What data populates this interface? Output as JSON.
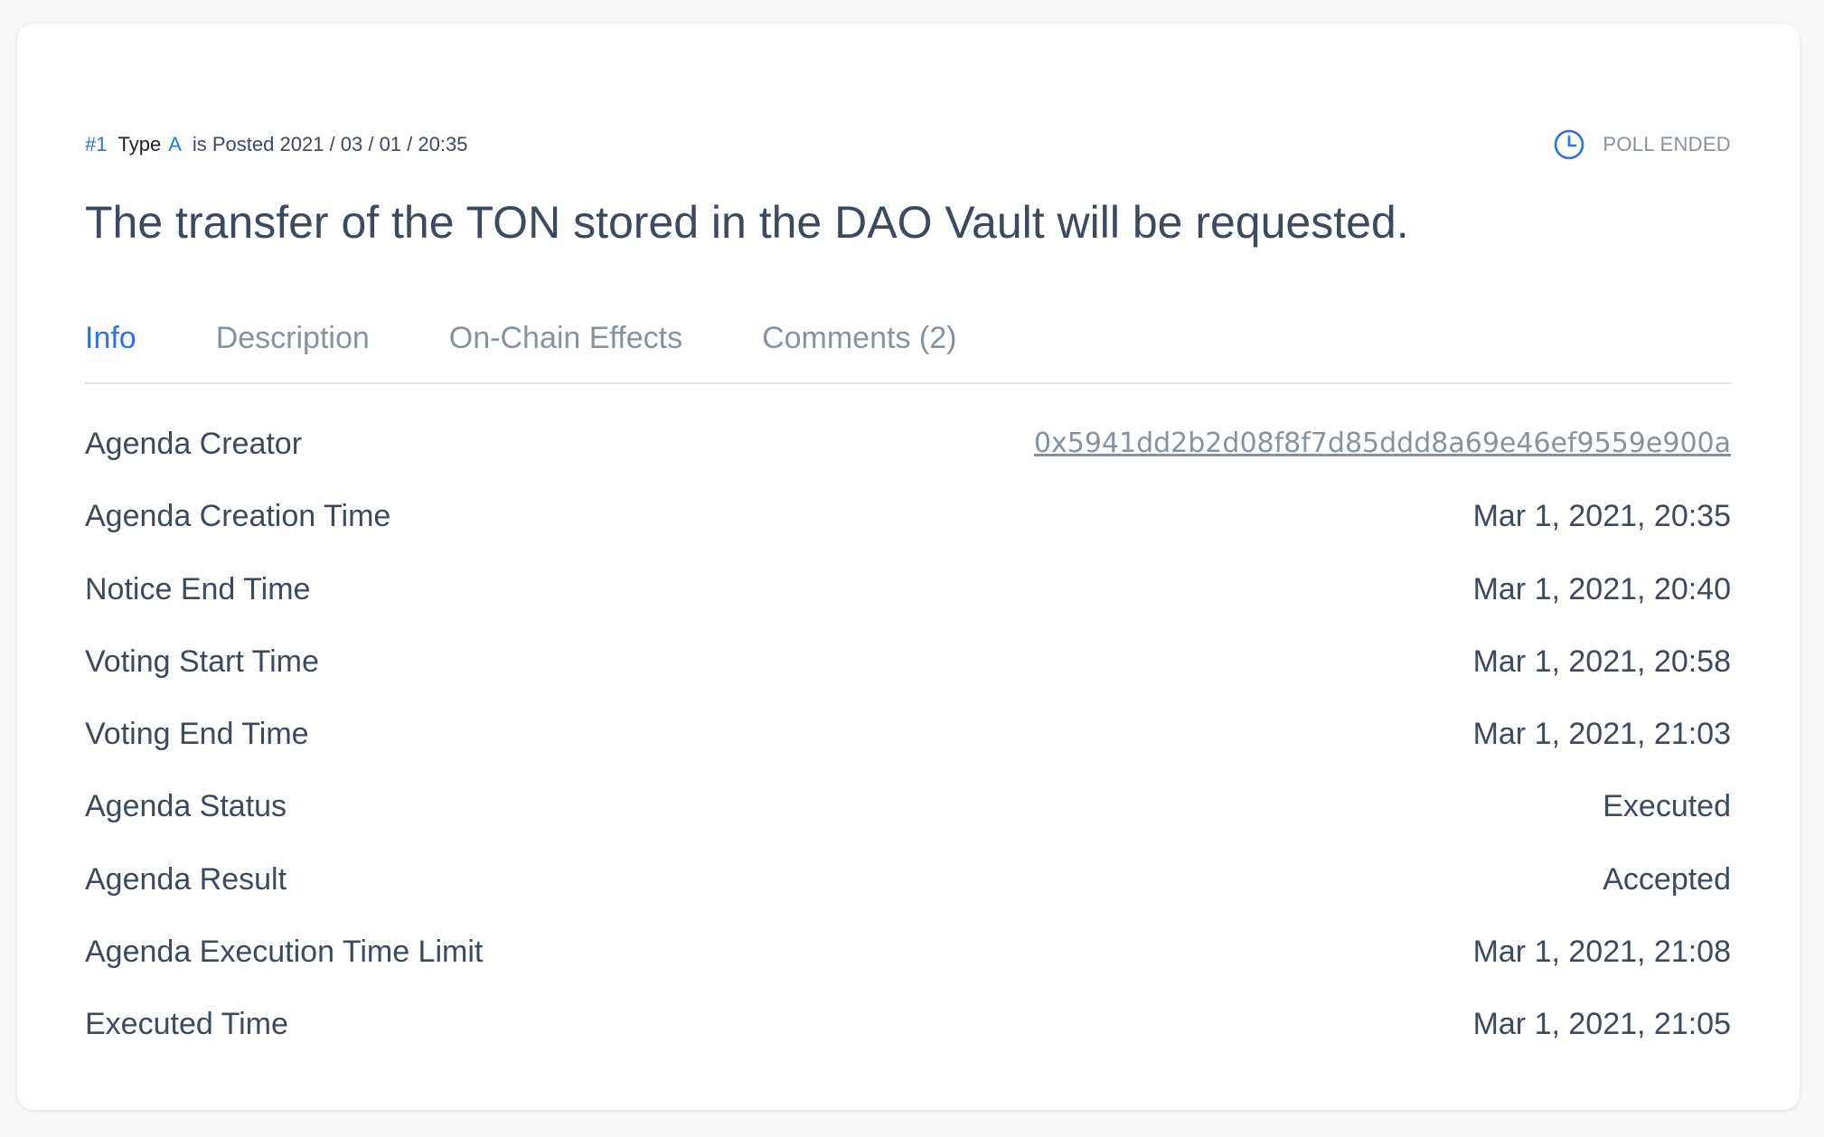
{
  "agenda": {
    "number": "#1",
    "type_label": "Type",
    "type_value": "A",
    "posted_text": "is Posted 2021 / 03 / 01 / 20:35",
    "status_label": "POLL ENDED",
    "title": "The transfer of the TON stored in the DAO Vault will be requested."
  },
  "tabs": [
    {
      "label": "Info",
      "active": true
    },
    {
      "label": "Description",
      "active": false
    },
    {
      "label": "On-Chain Effects",
      "active": false
    },
    {
      "label": "Comments (2)",
      "active": false
    }
  ],
  "info_rows": [
    {
      "label": "Agenda Creator",
      "value": "0x5941dd2b2d08f8f7d85ddd8a69e46ef9559e900a"
    },
    {
      "label": "Agenda Creation Time",
      "value": "Mar 1, 2021, 20:35"
    },
    {
      "label": "Notice End Time",
      "value": "Mar 1, 2021, 20:40"
    },
    {
      "label": "Voting Start Time",
      "value": "Mar 1, 2021, 20:58"
    },
    {
      "label": "Voting End Time",
      "value": "Mar 1, 2021, 21:03"
    },
    {
      "label": "Agenda Status",
      "value": "Executed"
    },
    {
      "label": "Agenda Result",
      "value": "Accepted"
    },
    {
      "label": "Agenda Execution Time Limit",
      "value": "Mar 1, 2021, 21:08"
    },
    {
      "label": "Executed Time",
      "value": "Mar 1, 2021, 21:05"
    }
  ],
  "icons": {
    "status_icon": "clock-icon"
  },
  "colors": {
    "accent": "#2a72e5",
    "muted": "#86929d",
    "text": "#3d495d",
    "divider": "#dfe4ee"
  }
}
